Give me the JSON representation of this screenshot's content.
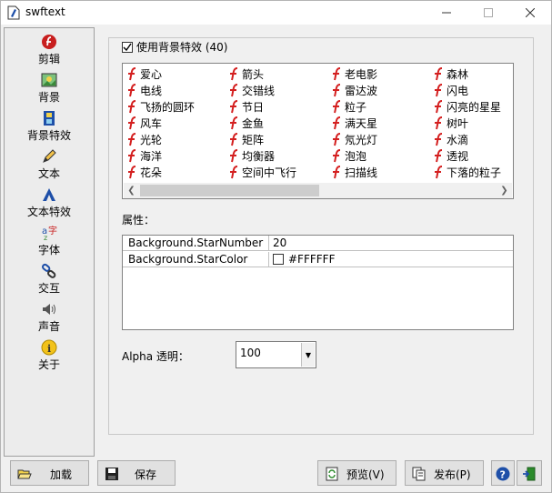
{
  "window": {
    "title": "swftext"
  },
  "sidebar": {
    "items": [
      {
        "label": "剪辑",
        "icon": "flash-icon"
      },
      {
        "label": "背景",
        "icon": "picture-icon"
      },
      {
        "label": "背景特效",
        "icon": "film-icon"
      },
      {
        "label": "文本",
        "icon": "pencil-icon"
      },
      {
        "label": "文本特效",
        "icon": "text-effect-icon"
      },
      {
        "label": "字体",
        "icon": "font-icon"
      },
      {
        "label": "交互",
        "icon": "link-icon"
      },
      {
        "label": "声音",
        "icon": "speaker-icon"
      },
      {
        "label": "关于",
        "icon": "info-icon"
      }
    ]
  },
  "effects": {
    "checkbox_label": "使用背景特效 (40)",
    "checked": true,
    "items": [
      "爱心",
      "箭头",
      "老电影",
      "森林",
      "电线",
      "交错线",
      "雷达波",
      "闪电",
      "飞扬的圆环",
      "节日",
      "粒子",
      "闪亮的星星",
      "风车",
      "金鱼",
      "满天星",
      "树叶",
      "光轮",
      "矩阵",
      "氖光灯",
      "水滴",
      "海洋",
      "均衡器",
      "泡泡",
      "透视",
      "花朵",
      "空间中飞行",
      "扫描线",
      "下落的粒子"
    ]
  },
  "properties": {
    "label": "属性：",
    "rows": [
      {
        "key": "Background.StarNumber",
        "value": "20",
        "swatch": null
      },
      {
        "key": "Background.StarColor",
        "value": "#FFFFFF",
        "swatch": "#FFFFFF"
      }
    ]
  },
  "alpha": {
    "label": "Alpha 透明：",
    "value": "100"
  },
  "buttons": {
    "load": "加载",
    "save": "保存",
    "preview": "预览(V)",
    "publish": "发布(P)"
  },
  "colors": {
    "flash_red": "#d42020",
    "accent_blue": "#1e4fa8"
  }
}
